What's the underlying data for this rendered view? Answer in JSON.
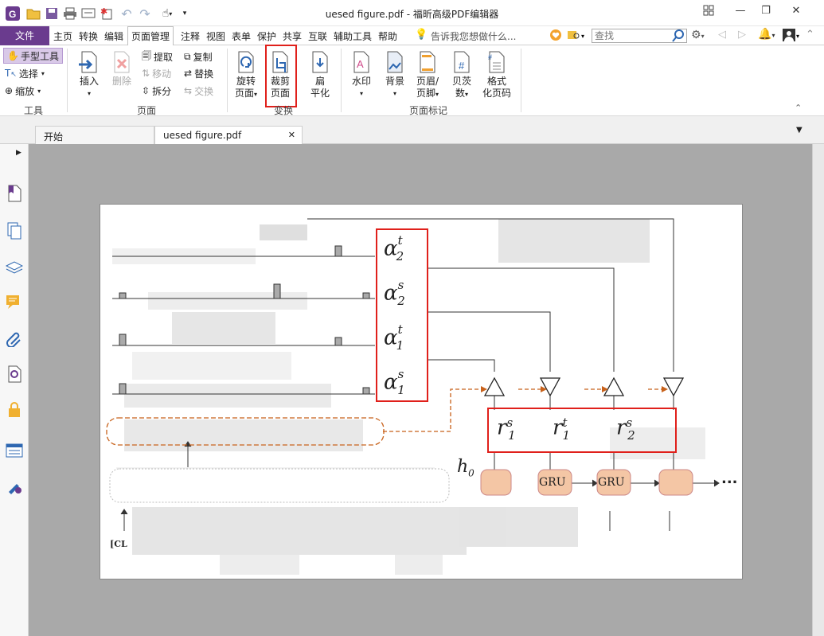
{
  "window": {
    "title": "uesed figure.pdf - 福昕高级PDF编辑器"
  },
  "menu": {
    "file": "文件",
    "items": [
      "主页",
      "转换",
      "编辑",
      "页面管理",
      "注释",
      "视图",
      "表单",
      "保护",
      "共享",
      "互联",
      "辅助工具",
      "帮助"
    ],
    "active": "页面管理",
    "tell_me": "告诉我您想做什么...",
    "search_placeholder": "查找"
  },
  "ribbon": {
    "tools": {
      "hand": "手型工具",
      "select": "选择",
      "zoom": "缩放",
      "group": "工具"
    },
    "page": {
      "insert": "插入",
      "delete": "删除",
      "extract": "提取",
      "move": "移动",
      "split": "拆分",
      "copy": "复制",
      "replace": "替换",
      "swap": "交换",
      "group": "页面"
    },
    "transform": {
      "rotate_line1": "旋转",
      "rotate_line2": "页面",
      "crop_line1": "裁剪",
      "crop_line2": "页面",
      "flatten_line1": "扁",
      "flatten_line2": "平化",
      "group": "变换"
    },
    "marks": {
      "watermark": "水印",
      "background": "背景",
      "header_line1": "页眉/",
      "header_line2": "页脚",
      "bates_line1": "贝茨",
      "bates_line2": "数",
      "format_line1": "格式",
      "format_line2": "化页码",
      "group": "页面标记"
    }
  },
  "tabs": {
    "start": "开始",
    "doc": "uesed figure.pdf"
  },
  "figure": {
    "alphas": [
      {
        "base": "α",
        "sup": "t",
        "sub": "2"
      },
      {
        "base": "α",
        "sup": "s",
        "sub": "2"
      },
      {
        "base": "α",
        "sup": "t",
        "sub": "1"
      },
      {
        "base": "α",
        "sup": "s",
        "sub": "1"
      }
    ],
    "rs": [
      {
        "base": "r",
        "sup": "s",
        "sub": "1"
      },
      {
        "base": "r",
        "sup": "t",
        "sub": "1"
      },
      {
        "base": "r",
        "sup": "s",
        "sub": "2"
      }
    ],
    "gru_label": "GRU",
    "h0": "h",
    "h0_sub": "0",
    "ellipsis": "...",
    "cls": "[CL"
  },
  "colors": {
    "accent": "#6a3b8e",
    "highlight": "#e0201b",
    "gru_fill": "#f4c6a5",
    "dashed": "#c8621b"
  }
}
